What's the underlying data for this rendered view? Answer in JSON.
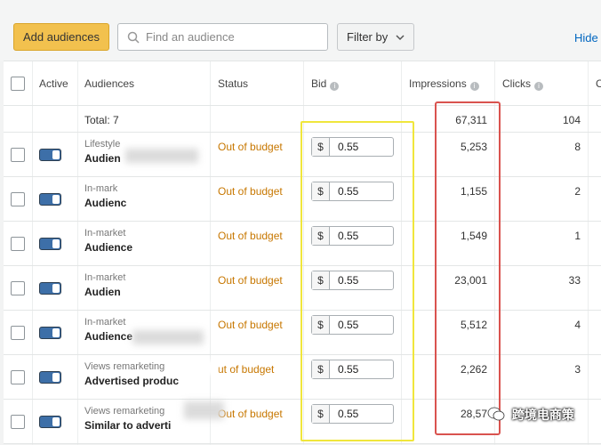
{
  "toolbar": {
    "add_label": "Add audiences",
    "search_placeholder": "Find an audience",
    "filter_label": "Filter by",
    "help_link": "Hide"
  },
  "columns": {
    "active": "Active",
    "audiences": "Audiences",
    "status": "Status",
    "bid": "Bid",
    "impressions": "Impressions",
    "clicks": "Clicks",
    "next": "C"
  },
  "total": {
    "label": "Total: 7",
    "impressions": "67,311",
    "clicks": "104"
  },
  "rows": [
    {
      "type": "Lifestyle",
      "name": "Audien",
      "status": "Out of budget",
      "currency": "$",
      "bid": "0.55",
      "impressions": "5,253",
      "clicks": "8"
    },
    {
      "type": "In-mark",
      "name": "Audienc",
      "status": "Out of budget",
      "currency": "$",
      "bid": "0.55",
      "impressions": "1,155",
      "clicks": "2"
    },
    {
      "type": "In-market",
      "name": "Audience",
      "status": "Out of budget",
      "currency": "$",
      "bid": "0.55",
      "impressions": "1,549",
      "clicks": "1"
    },
    {
      "type": "In-market",
      "name": "Audien",
      "status": "Out of budget",
      "currency": "$",
      "bid": "0.55",
      "impressions": "23,001",
      "clicks": "33"
    },
    {
      "type": "In-market",
      "name": "Audience",
      "status": "Out of budget",
      "currency": "$",
      "bid": "0.55",
      "impressions": "5,512",
      "clicks": "4"
    },
    {
      "type": "Views remarketing",
      "name": "Advertised produc",
      "status": "ut of budget",
      "currency": "$",
      "bid": "0.55",
      "impressions": "2,262",
      "clicks": "3"
    },
    {
      "type": "Views remarketing",
      "name": "Similar to adverti",
      "status": "Out of budget",
      "currency": "$",
      "bid": "0.55",
      "impressions": "28,57",
      "clicks": ""
    }
  ],
  "watermark": "跨境电商策",
  "colors": {
    "primary_button": "#f2c14e",
    "status_warning": "#c77700",
    "link": "#0066c0",
    "highlight_yellow": "#f0e63c",
    "highlight_red": "#d9534f"
  }
}
